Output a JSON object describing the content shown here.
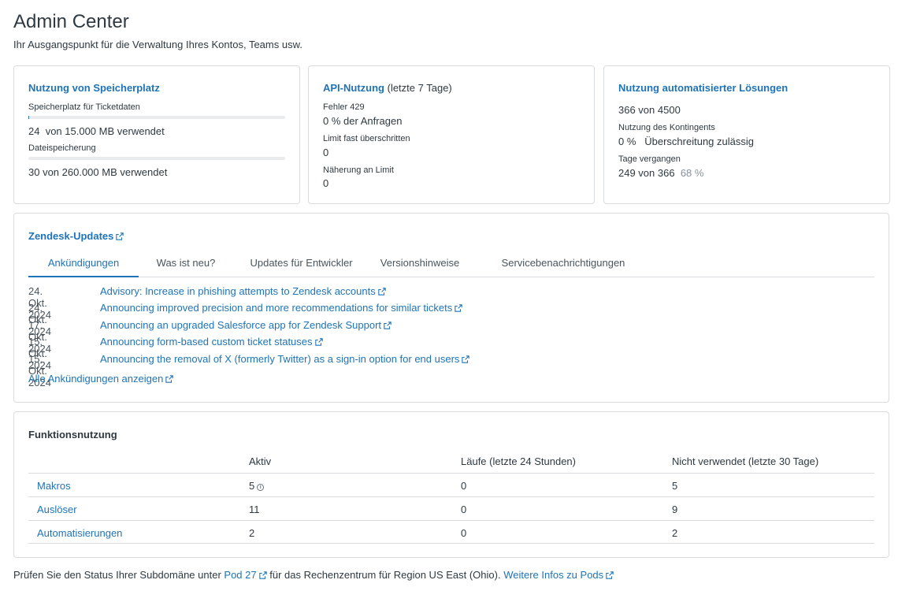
{
  "page": {
    "title": "Admin Center",
    "subtitle": "Ihr Ausgangspunkt für die Verwaltung Ihres Kontos, Teams usw."
  },
  "storage": {
    "title": "Nutzung von Speicherplatz",
    "ticket_label": "Speicherplatz für Ticketdaten",
    "ticket_used": "24",
    "ticket_text": "von 15.000 MB verwendet",
    "ticket_fraction": 0.0016,
    "file_label": "Dateispeicherung",
    "file_value": "30 von 260.000 MB verwendet",
    "file_fraction": 0.0001
  },
  "api": {
    "title": "API-Nutzung",
    "title_suffix": "(letzte 7 Tage)",
    "err_label": "Fehler 429",
    "err_value": "0 % der Anfragen",
    "limit_label": "Limit fast überschritten",
    "limit_value": "0",
    "near_label": "Näherung an Limit",
    "near_value": "0"
  },
  "auto": {
    "title": "Nutzung automatisierter Lösungen",
    "count": "366 von 4500",
    "quota_label": "Nutzung des Kontingents",
    "quota_pct": "0 %",
    "quota_text": "Überschreitung zulässig",
    "days_label": "Tage vergangen",
    "days_value": "249 von 366",
    "days_pct": "68 %"
  },
  "updates": {
    "title": "Zendesk-Updates",
    "tabs": [
      "Ankündigungen",
      "Was ist neu?",
      "Updates für Entwickler",
      "Versionshinweise",
      "Servicebenachrichtigungen"
    ],
    "items": [
      {
        "date": "24. Okt. 2024",
        "title": "Advisory: Increase in phishing attempts to Zendesk accounts"
      },
      {
        "date": "24. Okt. 2024",
        "title": "Announcing improved precision and more recommendations for similar tickets"
      },
      {
        "date": "17. Okt. 2024",
        "title": "Announcing an upgraded Salesforce app for Zendesk Support"
      },
      {
        "date": "15. Okt. 2024",
        "title": "Announcing form-based custom ticket statuses"
      },
      {
        "date": "15. Okt. 2024",
        "title": "Announcing the removal of X (formerly Twitter) as a sign-in option for end users"
      }
    ],
    "all_link": "Alle Ankündigungen anzeigen"
  },
  "features": {
    "title": "Funktionsnutzung",
    "headers": [
      "Aktiv",
      "Läufe (letzte 24 Stunden)",
      "Nicht verwendet (letzte 30 Tage)"
    ],
    "rows": [
      {
        "name": "Makros",
        "active": "5",
        "runs": "0",
        "unused": "5"
      },
      {
        "name": "Auslöser",
        "active": "11",
        "runs": "0",
        "unused": "9"
      },
      {
        "name": "Automatisierungen",
        "active": "2",
        "runs": "0",
        "unused": "2"
      }
    ]
  },
  "footer": {
    "prefix": "Prüfen Sie den Status Ihrer Subdomäne unter",
    "pod_link": "Pod 27",
    "middle": "für das Rechenzentrum für Region US East (Ohio).",
    "info_link": "Weitere Infos zu Pods"
  },
  "colors": {
    "link": "#1f73b7",
    "text": "#2f3941",
    "border": "#d8dcde",
    "muted": "#87929d"
  },
  "icons": {
    "external": "external-link-icon",
    "info": "info-icon"
  }
}
